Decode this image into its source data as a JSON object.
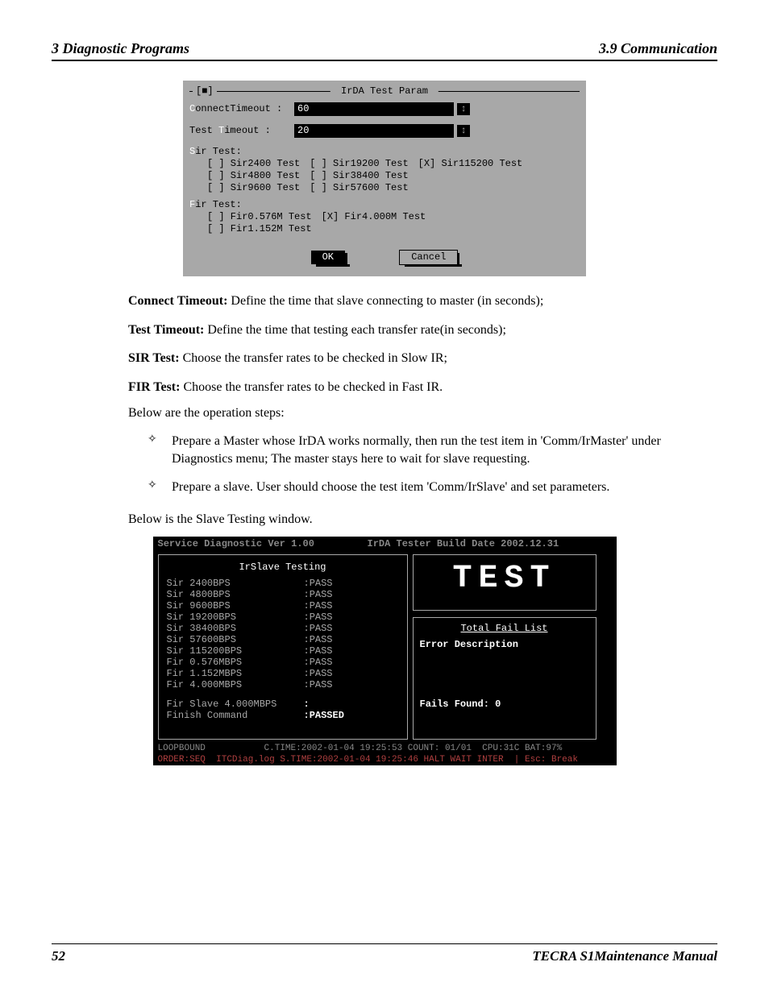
{
  "header": {
    "left": "3  Diagnostic Programs",
    "right": "3.9 Communication"
  },
  "dialog": {
    "close_glyph": "[■]",
    "title": " IrDA Test Param ",
    "connect_label_hot": "C",
    "connect_label_rest": "onnectTimeout :",
    "connect_value": "60",
    "test_label_pre": "Test ",
    "test_label_hot": "T",
    "test_label_post": "imeout :",
    "test_value": "20",
    "spin_glyph": "↕",
    "sir_title_hot": "S",
    "sir_title_rest": "ir Test:",
    "sir_rows": [
      [
        "[ ] Sir2400 Test",
        "[ ] Sir19200 Test",
        "[X] Sir115200 Test"
      ],
      [
        "[ ] Sir4800 Test",
        "[ ] Sir38400 Test",
        ""
      ],
      [
        "[ ] Sir9600 Test",
        "[ ] Sir57600 Test",
        ""
      ]
    ],
    "fir_title_hot": "F",
    "fir_title_rest": "ir Test:",
    "fir_rows": [
      [
        "[ ] Fir0.576M Test",
        "[X] Fir4.000M Test"
      ],
      [
        "[ ] Fir1.152M Test",
        ""
      ]
    ],
    "ok": "OK",
    "cancel": "Cancel"
  },
  "descs": [
    {
      "b": "Connect Timeout:",
      "t": " Define the time that slave connecting to master (in seconds);"
    },
    {
      "b": "Test Timeout:",
      "t": " Define the time that testing each transfer rate(in seconds);"
    },
    {
      "b": "SIR Test:",
      "t": " Choose the transfer rates to be checked in Slow IR;"
    },
    {
      "b": "FIR Test:",
      "t": " Choose the transfer rates to be checked in Fast IR."
    }
  ],
  "ops_intro": "Below are the operation steps:",
  "ops": [
    "Prepare a Master whose IrDA works normally, then run the test item in 'Comm/IrMaster' under Diagnostics menu; The master stays here to wait for slave requesting.",
    "Prepare a slave. User should choose the test item 'Comm/IrSlave' and set parameters."
  ],
  "slave_intro": "Below is the Slave Testing window.",
  "win": {
    "title_left": "Service Diagnostic Ver 1.00",
    "title_right": "IrDA Tester Build Date 2002.12.31",
    "panel_title": "IrSlave Testing",
    "results": [
      [
        "Sir 2400BPS",
        ":PASS"
      ],
      [
        "Sir 4800BPS",
        ":PASS"
      ],
      [
        "Sir 9600BPS",
        ":PASS"
      ],
      [
        "Sir 19200BPS",
        ":PASS"
      ],
      [
        "Sir 38400BPS",
        ":PASS"
      ],
      [
        "Sir 57600BPS",
        ":PASS"
      ],
      [
        "Sir 115200BPS",
        ":PASS"
      ],
      [
        "Fir 0.576MBPS",
        ":PASS"
      ],
      [
        "Fir 1.152MBPS",
        ":PASS"
      ],
      [
        "Fir 4.000MBPS",
        ":PASS"
      ]
    ],
    "extra": [
      [
        "Fir Slave 4.000MBPS",
        ":"
      ],
      [
        "Finish Command",
        ":PASSED"
      ]
    ],
    "test_word": "TEST",
    "fail_title": "Total Fail List",
    "fail_head": "Error  Description",
    "fails_found": "Fails Found: 0",
    "status1": "LOOPBOUND           C.TIME:2002-01-04 19:25:53 COUNT: 01/01  CPU:31C BAT:97%",
    "status2": "ORDER:SEQ  ITCDiag.log S.TIME:2002-01-04 19:25:46 HALT WAIT INTER  | Esc: Break"
  },
  "footer": {
    "page": "52",
    "manual": "TECRA S1Maintenance Manual"
  }
}
